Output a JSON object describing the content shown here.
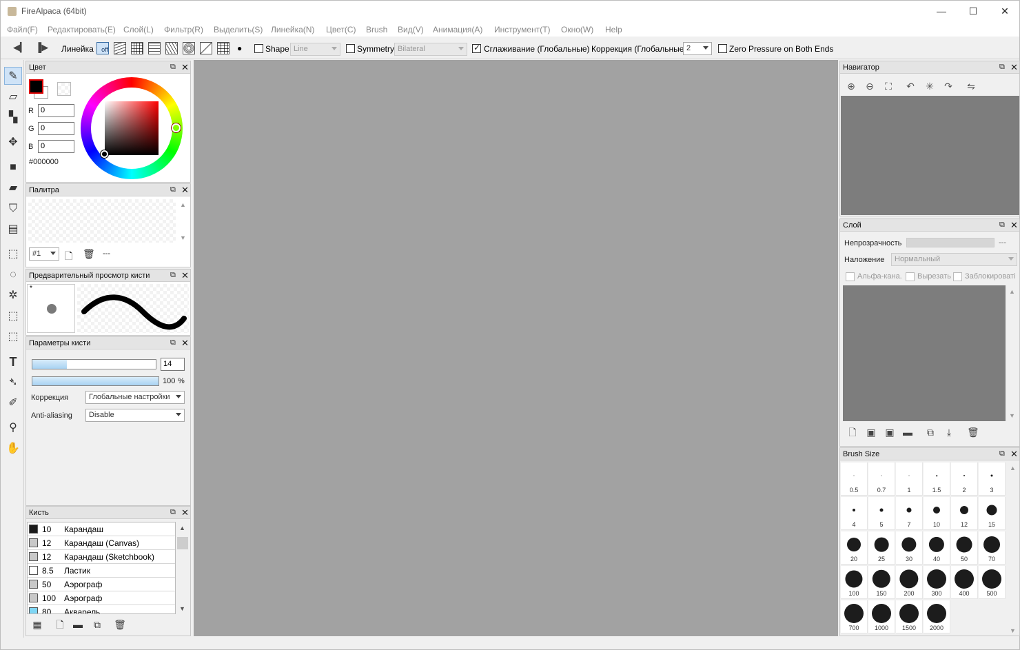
{
  "window": {
    "title": "FireAlpaca (64bit)",
    "minimize": "—",
    "maximize": "☐",
    "close": "✕"
  },
  "menu": [
    "Файл(F)",
    "Редактировать(E)",
    "Слой(L)",
    "Фильтр(R)",
    "Выделить(S)",
    "Линейка(N)",
    "Цвет(C)",
    "Brush",
    "Вид(V)",
    "Анимация(A)",
    "Инструмент(T)",
    "Окно(W)",
    "Help"
  ],
  "toolbar": {
    "ruler_label": "Линейка",
    "ruler_off": "off",
    "shape_label": "Shape",
    "shape_value": "Line",
    "shape_checked": false,
    "symmetry_label": "Symmetry",
    "symmetry_value": "Bilateral",
    "symmetry_checked": false,
    "smoothing_label": "Сглаживание (Глобальные)",
    "smoothing_checked": true,
    "correction_label": "Коррекция (Глобальные)",
    "correction_value": "2",
    "zero_pressure_label": "Zero Pressure on Both Ends",
    "zero_pressure_checked": false
  },
  "color_panel": {
    "title": "Цвет",
    "r_label": "R",
    "g_label": "G",
    "b_label": "B",
    "r": "0",
    "g": "0",
    "b": "0",
    "hex": "#000000",
    "primary_color": "#000000"
  },
  "palette_panel": {
    "title": "Палитра",
    "palette_select": "#1",
    "dash": "---"
  },
  "brush_preview_panel": {
    "title": "Предварительный просмотр кисти",
    "star": "*"
  },
  "brush_params_panel": {
    "title": "Параметры кисти",
    "size_value": "14",
    "opacity_value": "100",
    "opacity_unit": "%",
    "correction_label": "Коррекция",
    "correction_value": "Глобальные настройки",
    "aa_label": "Anti-aliasing",
    "aa_value": "Disable"
  },
  "brush_panel": {
    "title": "Кисть",
    "items": [
      {
        "size": "10",
        "name": "Карандаш",
        "color": "#1a1a1a"
      },
      {
        "size": "12",
        "name": "Карандаш (Canvas)",
        "color": "#c8c8c8"
      },
      {
        "size": "12",
        "name": "Карандаш (Sketchbook)",
        "color": "#c8c8c8"
      },
      {
        "size": "8.5",
        "name": "Ластик",
        "color": "#ffffff"
      },
      {
        "size": "50",
        "name": "Аэрограф",
        "color": "#c8c8c8"
      },
      {
        "size": "100",
        "name": "Аэрограф",
        "color": "#c8c8c8"
      },
      {
        "size": "80",
        "name": "Акварель",
        "color": "#7fd6f4"
      }
    ]
  },
  "navigator_panel": {
    "title": "Навигатор"
  },
  "layer_panel": {
    "title": "Слой",
    "opacity_label": "Непрозрачность",
    "opacity_value": "---",
    "blend_label": "Наложение",
    "blend_value": "Нормальный",
    "alpha_label": "Альфа-кана.",
    "clip_label": "Вырезать",
    "lock_label": "Заблокироваті"
  },
  "brush_size_panel": {
    "title": "Brush Size",
    "sizes": [
      "0.5",
      "0.7",
      "1",
      "1.5",
      "2",
      "3",
      "4",
      "5",
      "7",
      "10",
      "12",
      "15",
      "20",
      "25",
      "30",
      "40",
      "50",
      "70",
      "100",
      "150",
      "200",
      "300",
      "400",
      "500",
      "700",
      "1000",
      "1500",
      "2000"
    ]
  }
}
